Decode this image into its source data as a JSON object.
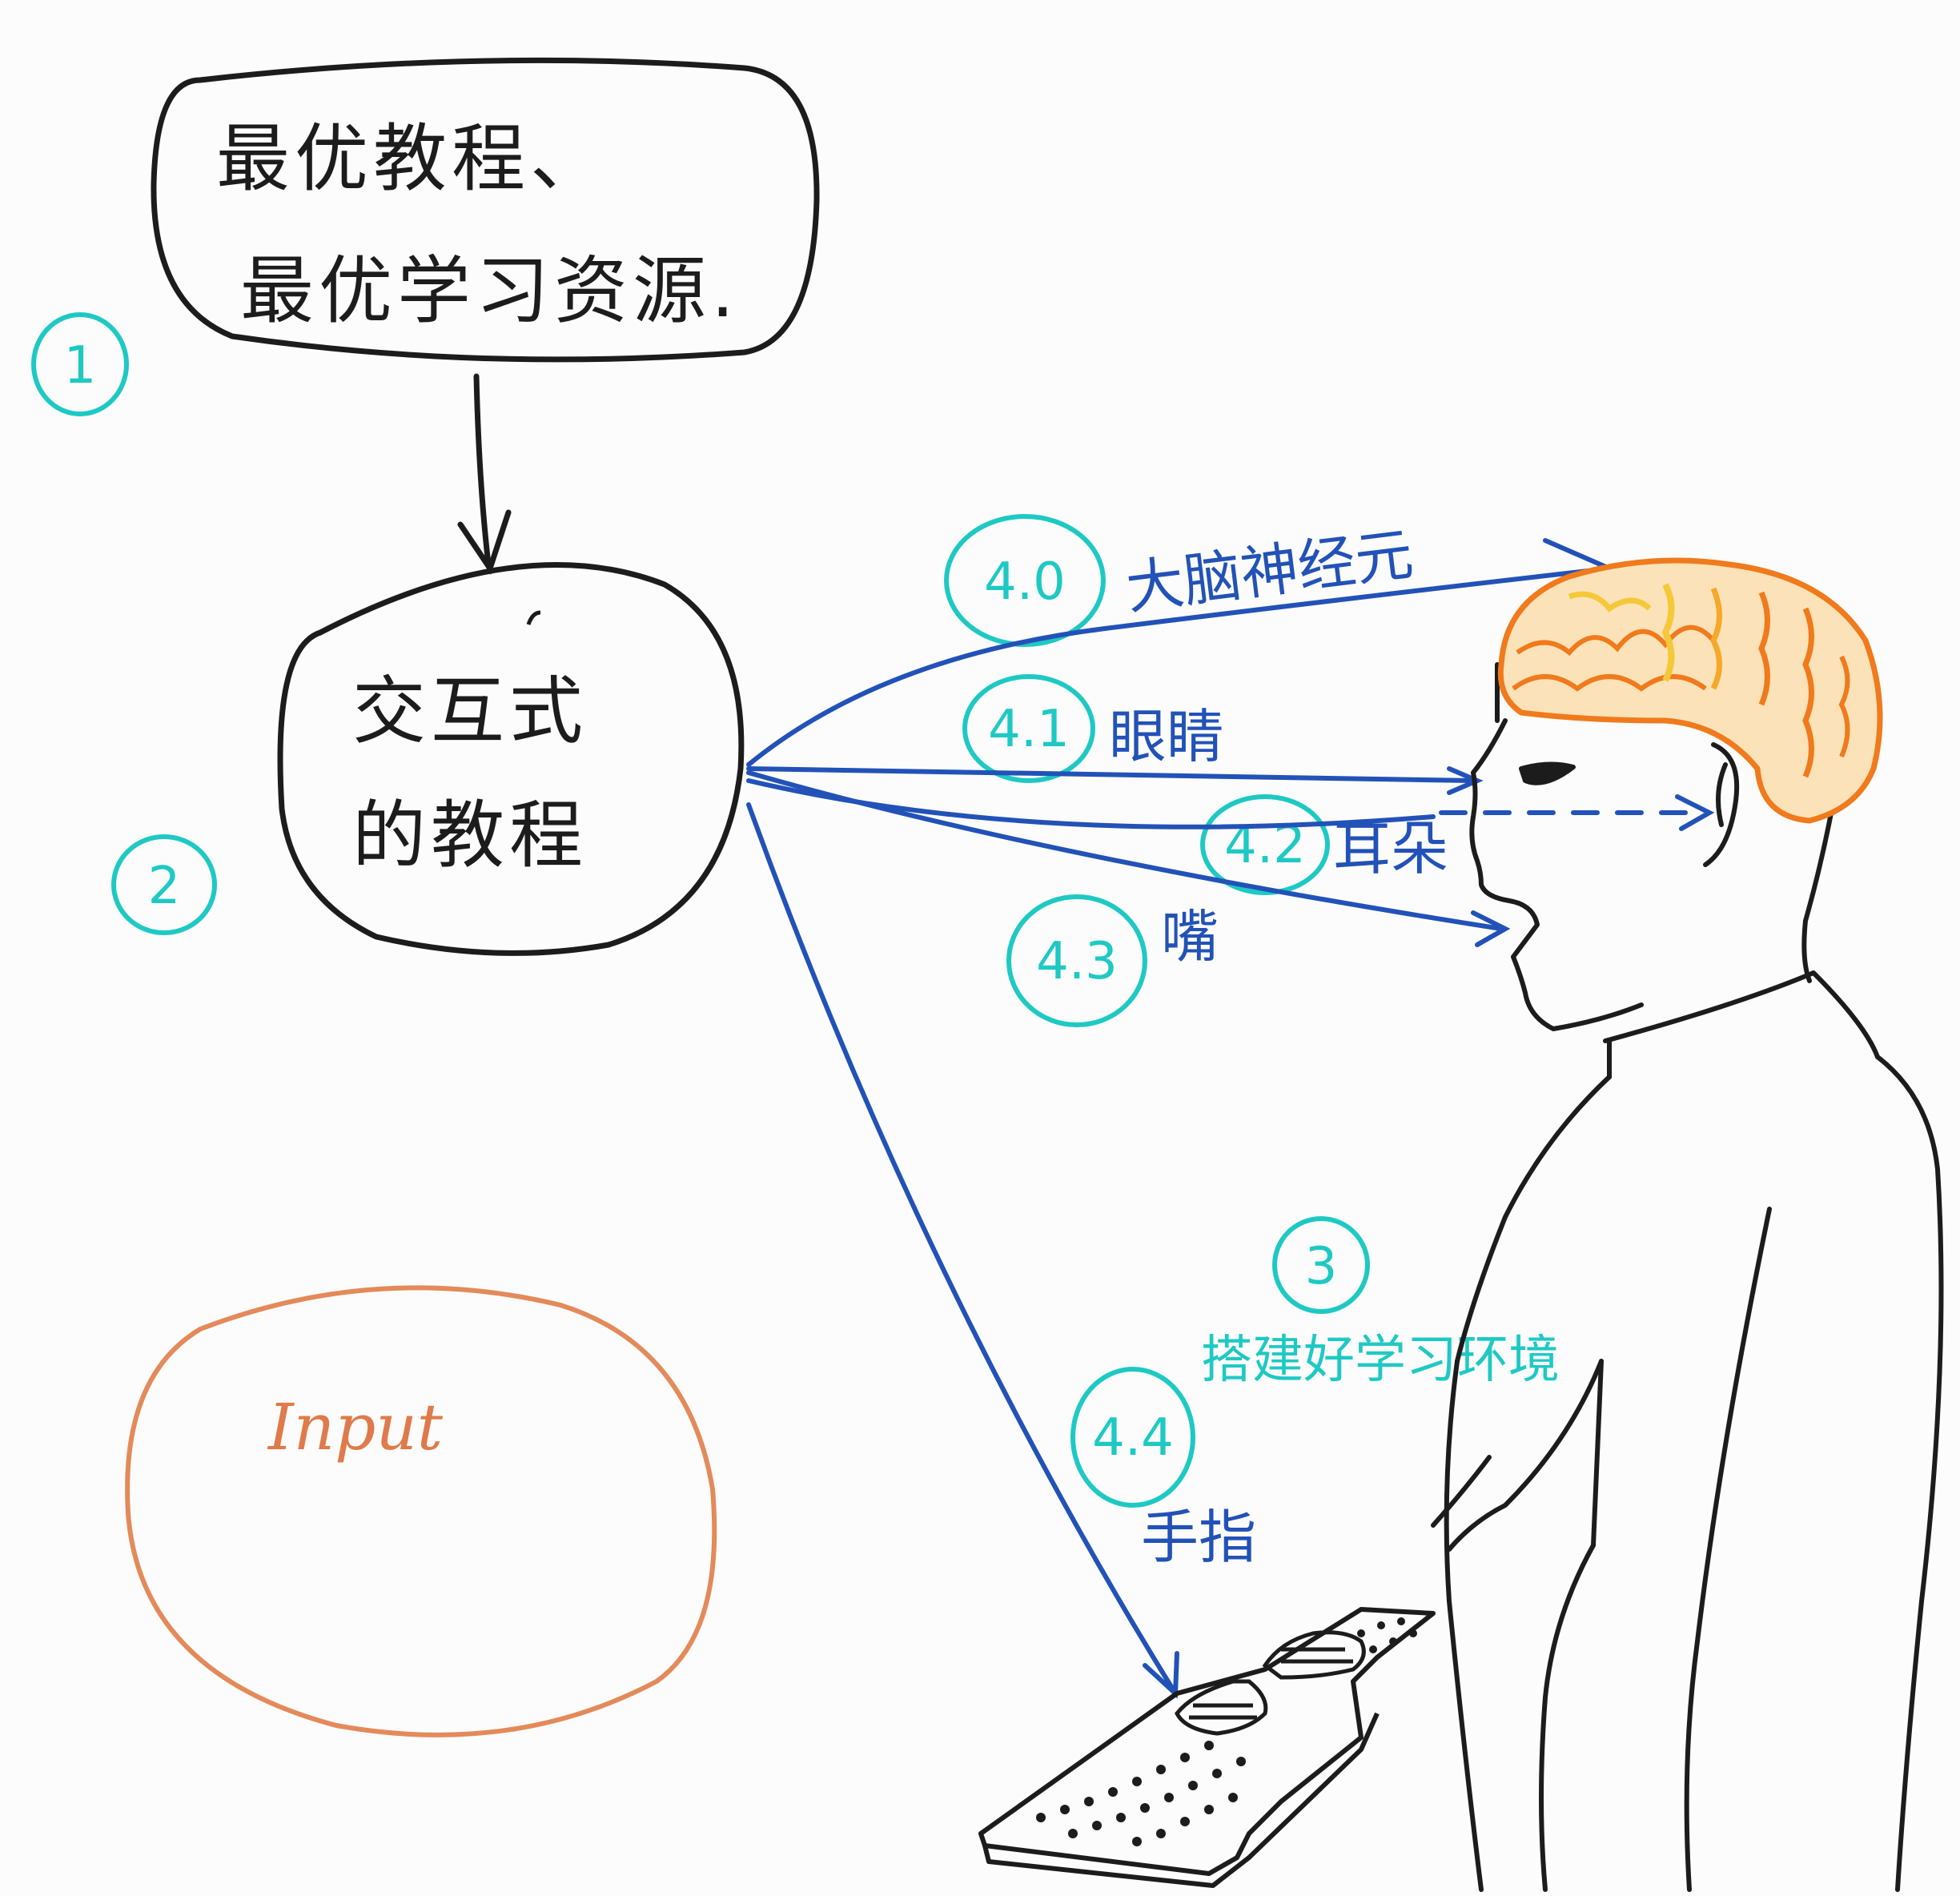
{
  "top_box": {
    "line1": "最优教程、",
    "line2": "最优学习资源."
  },
  "middle_box": {
    "line1": "交互式",
    "line2": "的教程"
  },
  "input_bubble": {
    "label": "Input"
  },
  "steps": {
    "s1": "1",
    "s2": "2",
    "s3": "3",
    "s40": "4.0",
    "s41": "4.1",
    "s42": "4.2",
    "s43": "4.3",
    "s44": "4.4"
  },
  "channels": {
    "brain": "大脑神经元",
    "eyes": "眼睛",
    "ears": "耳朵",
    "mouth": "嘴",
    "fingers": "手指"
  },
  "environment_label": "搭建好学习环境",
  "colors": {
    "ink": "#1c1c1c",
    "teal": "#1ec9c4",
    "blue": "#2252b8",
    "orange": "#e07a4a",
    "brain_orange": "#f07a1c",
    "brain_yellow": "#f5c83a"
  }
}
